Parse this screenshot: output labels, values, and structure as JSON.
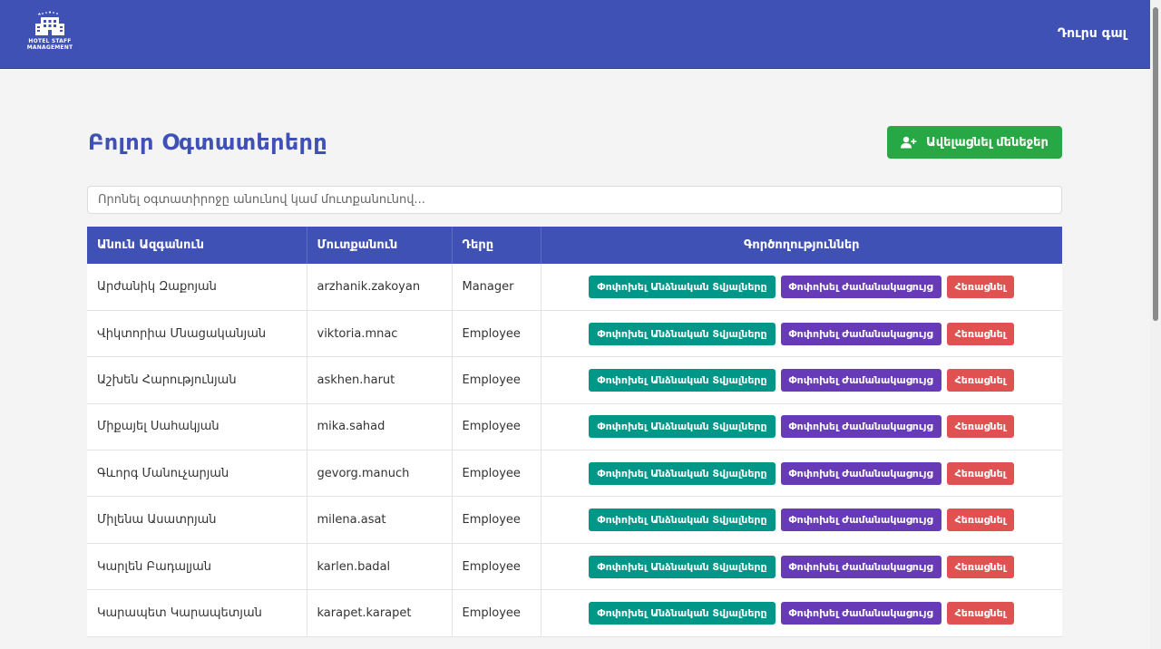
{
  "header": {
    "logo_text": [
      "HOTEL STAFF",
      "MANAGEMENT"
    ],
    "logout_label": "Դուրս գալ"
  },
  "page": {
    "title": "Բոլոր Օգտատերերը",
    "add_button_label": "Ավելացնել մենեջեր"
  },
  "search": {
    "placeholder": "Որոնել օգտատիրոջը անունով կամ մուտքանունով..."
  },
  "table": {
    "headers": {
      "name": "Անուն Ազգանուն",
      "username": "Մուտքանուն",
      "role": "Դերը",
      "actions": "Գործողություններ"
    },
    "actions": {
      "edit": "Փոփոխել Անձնական Տվյալները",
      "schedule": "Փոփոխել Ժամանակացույց",
      "delete": "Հեռացնել"
    },
    "rows": [
      {
        "name": "Արժանիկ Զաքոյան",
        "username": "arzhanik.zakoyan",
        "role": "Manager"
      },
      {
        "name": "Վիկտորիա Մնացականյան",
        "username": "viktoria.mnac",
        "role": "Employee"
      },
      {
        "name": "Աշխեն Հարությունյան",
        "username": "askhen.harut",
        "role": "Employee"
      },
      {
        "name": "Միքայել Սահակյան",
        "username": "mika.sahad",
        "role": "Employee"
      },
      {
        "name": "Գևորգ Մանուչարյան",
        "username": "gevorg.manuch",
        "role": "Employee"
      },
      {
        "name": "Միլենա Ասատրյան",
        "username": "milena.asat",
        "role": "Employee"
      },
      {
        "name": "Կարլեն Բադալյան",
        "username": "karlen.badal",
        "role": "Employee"
      },
      {
        "name": "Կարապետ Կարապետյան",
        "username": "karapet.karapet",
        "role": "Employee"
      }
    ]
  },
  "colors": {
    "primary": "#3f51b5",
    "success": "#28a745",
    "teal": "#009688",
    "purple": "#673ab7",
    "danger": "#e05252"
  },
  "icons": {
    "logo": "hotel-building-icon",
    "add_button": "user-plus-icon"
  }
}
